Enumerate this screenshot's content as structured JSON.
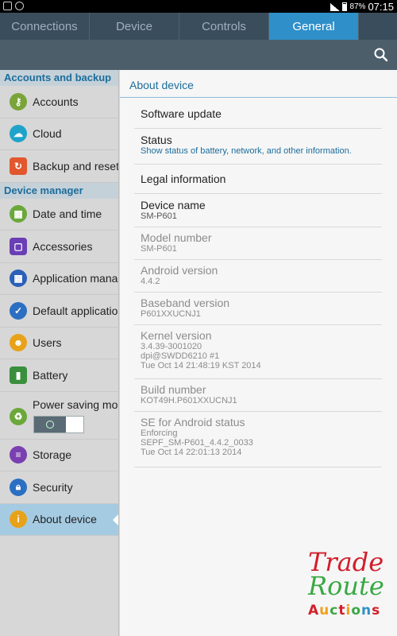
{
  "status_bar": {
    "battery_percent": "87%",
    "time": "07:15"
  },
  "tabs": [
    {
      "label": "Connections"
    },
    {
      "label": "Device"
    },
    {
      "label": "Controls"
    },
    {
      "label": "General"
    }
  ],
  "sidebar": {
    "section_accounts": "Accounts and backup",
    "section_device": "Device manager",
    "items": [
      {
        "label": "Accounts",
        "icon": "key-icon"
      },
      {
        "label": "Cloud",
        "icon": "cloud-icon"
      },
      {
        "label": "Backup and reset",
        "icon": "backup-icon"
      },
      {
        "label": "Date and time",
        "icon": "calendar-icon"
      },
      {
        "label": "Accessories",
        "icon": "accessories-icon"
      },
      {
        "label": "Application manager",
        "icon": "app-grid-icon"
      },
      {
        "label": "Default applications",
        "icon": "default-apps-icon"
      },
      {
        "label": "Users",
        "icon": "users-icon"
      },
      {
        "label": "Battery",
        "icon": "battery-icon"
      },
      {
        "label": "Power saving mode",
        "icon": "power-saving-icon"
      },
      {
        "label": "Storage",
        "icon": "storage-icon"
      },
      {
        "label": "Security",
        "icon": "lock-icon"
      },
      {
        "label": "About device",
        "icon": "info-icon"
      }
    ]
  },
  "about": {
    "title": "About device",
    "software_update": "Software update",
    "status_title": "Status",
    "status_desc": "Show status of battery, network, and other information.",
    "legal": "Legal information",
    "device_name_label": "Device name",
    "device_name": "SM-P601",
    "model_label": "Model number",
    "model": "SM-P601",
    "android_label": "Android version",
    "android": "4.4.2",
    "baseband_label": "Baseband version",
    "baseband": "P601XXUCNJ1",
    "kernel_label": "Kernel version",
    "kernel_1": "3.4.39-3001020",
    "kernel_2": "dpi@SWDD6210 #1",
    "kernel_3": "Tue Oct 14 21:48:19 KST 2014",
    "build_label": "Build number",
    "build": "KOT49H.P601XXUCNJ1",
    "se_label": "SE for Android status",
    "se_1": "Enforcing",
    "se_2": "SEPF_SM-P601_4.4.2_0033",
    "se_3": "Tue Oct 14 22:01:13 2014"
  },
  "watermark": {
    "line1": "Trade",
    "line2": "Route",
    "line3": "Auctions"
  },
  "colors": {
    "accent": "#2e8fc9",
    "section_text": "#1c6d9c",
    "active_item": "#a5cbe2"
  }
}
